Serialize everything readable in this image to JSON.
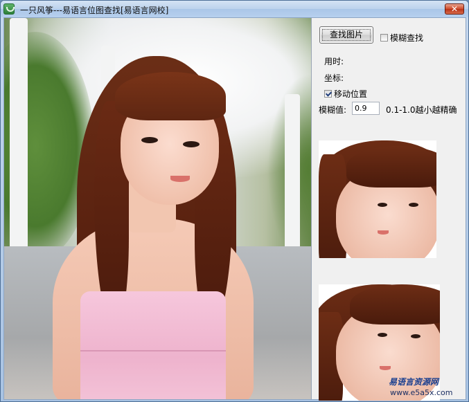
{
  "window": {
    "title": "一只风筝---易语言位图查找[易语言网校]",
    "close_label": "✕"
  },
  "controls": {
    "find_button_label": "查找图片",
    "fuzzy_checkbox_label": "模糊查找",
    "fuzzy_checked": false,
    "time_label": "用时:",
    "coord_label": "坐标:",
    "move_checkbox_label": "移动位置",
    "move_checked": true,
    "fuzzy_value_label": "模糊值:",
    "fuzzy_value": "0.9",
    "fuzzy_hint": "0.1-1.0越小越精确"
  },
  "watermark": {
    "text": "易语言资源网",
    "url": "www.e5a5x.com"
  },
  "icons": {
    "app": "app-icon",
    "close": "close-icon"
  }
}
